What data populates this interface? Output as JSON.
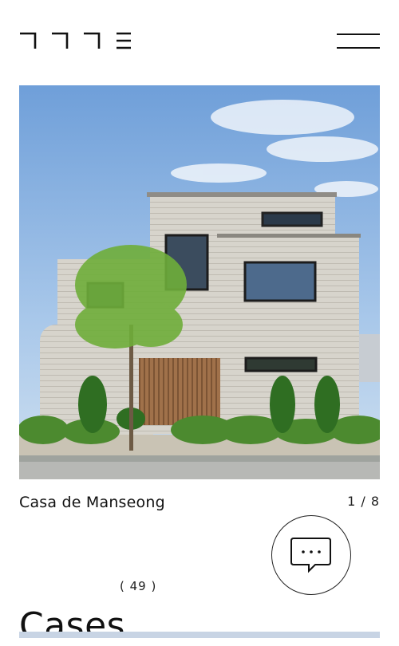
{
  "brand": {
    "logo_icon": "korean-jamo-logo"
  },
  "header": {
    "menu_icon": "hamburger-menu-icon"
  },
  "hero": {
    "image_description_icon": "house-photo",
    "caption": "Casa de Manseong",
    "counter": "1 / 8"
  },
  "chat": {
    "icon": "chat-bubble-icon"
  },
  "cases": {
    "title": "Cases",
    "count": "( 49 )"
  }
}
